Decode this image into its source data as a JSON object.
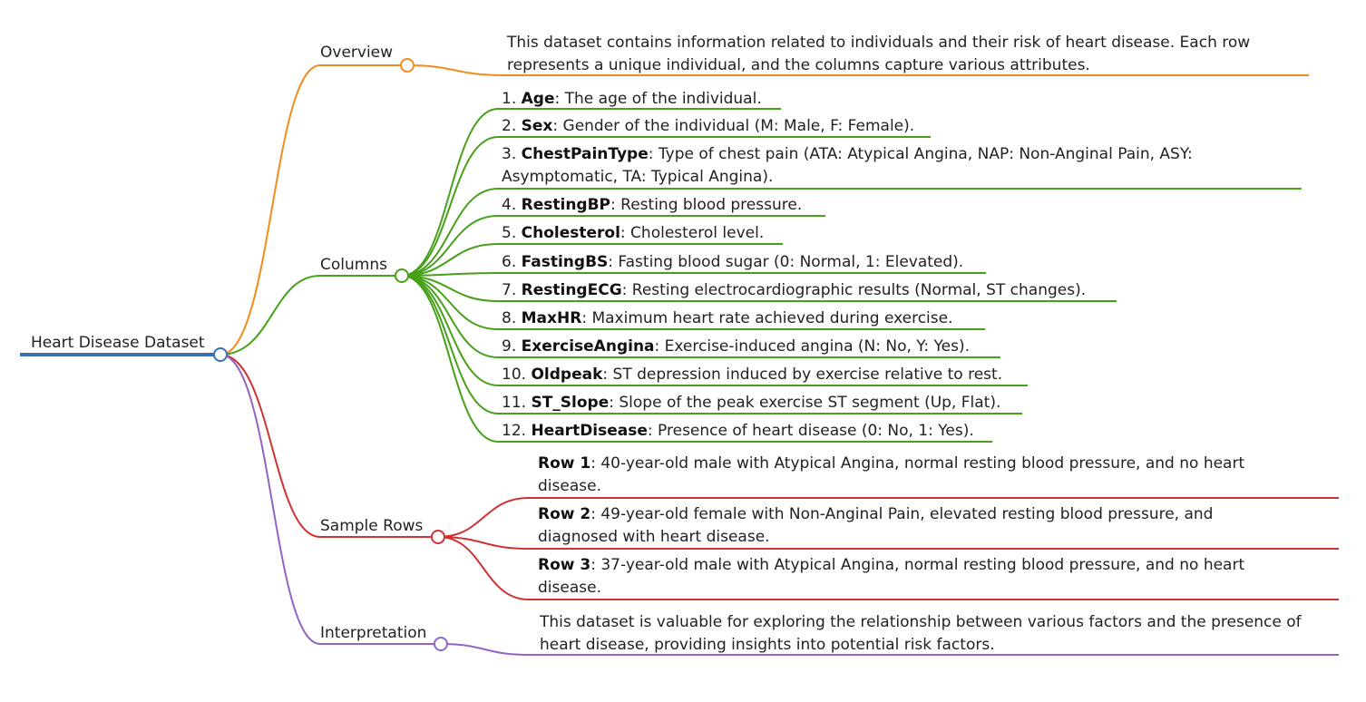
{
  "root": {
    "label": "Heart Disease Dataset"
  },
  "branches": {
    "overview": {
      "label": "Overview",
      "text": "This dataset contains information related to individuals and their risk of heart disease. Each row represents a unique individual, and the columns capture various attributes."
    },
    "columns": {
      "label": "Columns",
      "items": [
        {
          "num": "1.",
          "name": "Age",
          "desc": ": The age of the individual."
        },
        {
          "num": "2.",
          "name": "Sex",
          "desc": ": Gender of the individual (M: Male, F: Female)."
        },
        {
          "num": "3.",
          "name": "ChestPainType",
          "desc": ": Type of chest pain (ATA: Atypical Angina, NAP: Non-Anginal Pain, ASY: Asymptomatic, TA: Typical Angina)."
        },
        {
          "num": "4.",
          "name": "RestingBP",
          "desc": ": Resting blood pressure."
        },
        {
          "num": "5.",
          "name": "Cholesterol",
          "desc": ": Cholesterol level."
        },
        {
          "num": "6.",
          "name": "FastingBS",
          "desc": ": Fasting blood sugar (0: Normal, 1: Elevated)."
        },
        {
          "num": "7.",
          "name": "RestingECG",
          "desc": ": Resting electrocardiographic results (Normal, ST changes)."
        },
        {
          "num": "8.",
          "name": "MaxHR",
          "desc": ": Maximum heart rate achieved during exercise."
        },
        {
          "num": "9.",
          "name": "ExerciseAngina",
          "desc": ": Exercise-induced angina (N: No, Y: Yes)."
        },
        {
          "num": "10.",
          "name": "Oldpeak",
          "desc": ": ST depression induced by exercise relative to rest."
        },
        {
          "num": "11.",
          "name": "ST_Slope",
          "desc": ": Slope of the peak exercise ST segment (Up, Flat)."
        },
        {
          "num": "12.",
          "name": "HeartDisease",
          "desc": ": Presence of heart disease (0: No, 1: Yes)."
        }
      ]
    },
    "sample_rows": {
      "label": "Sample Rows",
      "items": [
        {
          "name": "Row 1",
          "desc": ": 40-year-old male with Atypical Angina, normal resting blood pressure, and no heart disease."
        },
        {
          "name": "Row 2",
          "desc": ": 49-year-old female with Non-Anginal Pain, elevated resting blood pressure, and diagnosed with heart disease."
        },
        {
          "name": "Row 3",
          "desc": ": 37-year-old male with Atypical Angina, normal resting blood pressure, and no heart disease."
        }
      ]
    },
    "interpretation": {
      "label": "Interpretation",
      "text": "This dataset is valuable for exploring the relationship between various factors and the presence of heart disease, providing insights into potential risk factors."
    }
  },
  "colors": {
    "root": "#3a6fb0",
    "overview": "#f28c1b",
    "columns": "#46a018",
    "sample_rows": "#d03232",
    "interpretation": "#9264c4"
  }
}
